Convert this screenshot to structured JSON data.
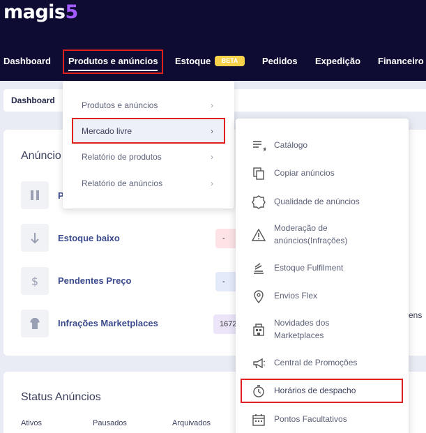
{
  "header": {
    "logo_main": "magis",
    "logo_accent": "5",
    "nav": {
      "dashboard": "Dashboard",
      "produtos": "Produtos e anúncios",
      "estoque": "Estoque",
      "beta": "BETA",
      "pedidos": "Pedidos",
      "expedicao": "Expedição",
      "financeiro": "Financeiro"
    }
  },
  "breadcrumb": "Dashboard",
  "card1": {
    "title": "Anúncio",
    "rows": [
      {
        "icon": "pause-icon",
        "label": "P",
        "value": ""
      },
      {
        "icon": "arrow-down-icon",
        "label": "Estoque baixo",
        "value": "-"
      },
      {
        "icon": "dollar-icon",
        "label": "Pendentes Preço",
        "value": "-"
      },
      {
        "icon": "shirt-icon",
        "label": "Infrações Marketplaces",
        "value": "1672"
      }
    ],
    "side_text": "ens"
  },
  "card2": {
    "title": "Status Anúncios",
    "columns": [
      "Ativos",
      "Pausados",
      "Arquivados"
    ]
  },
  "menu1": {
    "items": [
      {
        "label": "Produtos e anúncios"
      },
      {
        "label": "Mercado livre"
      },
      {
        "label": "Relatório de produtos"
      },
      {
        "label": "Relatório de anúncios"
      }
    ],
    "chevron": "›"
  },
  "menu2": {
    "items": [
      {
        "label": "Catálogo",
        "icon": "catalog-list-icon"
      },
      {
        "label": "Copiar anúncios",
        "icon": "copy-icon"
      },
      {
        "label": "Qualidade de anúncios",
        "icon": "quality-badge-icon"
      },
      {
        "label_line1": "Moderação de",
        "label_line2": "anúncios(Infrações)",
        "icon": "warning-icon"
      },
      {
        "label": "Estoque Fulfilment",
        "icon": "stack-icon"
      },
      {
        "label": "Envios Flex",
        "icon": "location-pin-icon"
      },
      {
        "label_line1": "Novidades dos",
        "label_line2": "Marketplaces",
        "icon": "store-icon"
      },
      {
        "label": "Central de Promoções",
        "icon": "megaphone-icon"
      },
      {
        "label": "Horários de despacho",
        "icon": "timer-icon"
      },
      {
        "label": "Pontos Facultativos",
        "icon": "calendar-icon"
      }
    ]
  },
  "colors": {
    "header_bg": "#0f0c33",
    "accent": "#a35bff",
    "highlight_border": "#e0201f",
    "beta": "#f8d24b"
  }
}
